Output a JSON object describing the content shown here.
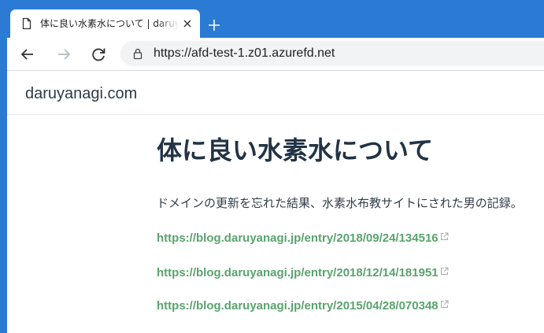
{
  "browser": {
    "tab": {
      "title": "体に良い水素水について | daruyanagi.com",
      "favicon": "page-icon",
      "close_icon": "close-icon"
    },
    "new_tab_icon": "plus-icon",
    "toolbar": {
      "back_icon": "back-arrow-icon",
      "forward_icon": "forward-arrow-icon",
      "reload_icon": "reload-icon",
      "lock_icon": "lock-icon",
      "url": "https://afd-test-1.z01.azurefd.net"
    },
    "colors": {
      "frame": "#2b7bd4",
      "omnibox": "#f1f3f4"
    }
  },
  "site": {
    "title": "daruyanagi.com",
    "article": {
      "title": "体に良い水素水について",
      "description": "ドメインの更新を忘れた結果、水素水布教サイトにされた男の記録。",
      "links": [
        {
          "text": "https://blog.daruyanagi.jp/entry/2018/09/24/134516",
          "icon": "external-link-icon"
        },
        {
          "text": "https://blog.daruyanagi.jp/entry/2018/12/14/181951",
          "icon": "external-link-icon"
        },
        {
          "text": "https://blog.daruyanagi.jp/entry/2015/04/28/070348",
          "icon": "external-link-icon"
        }
      ]
    },
    "colors": {
      "link": "#5aa36e",
      "heading": "#223344"
    }
  }
}
